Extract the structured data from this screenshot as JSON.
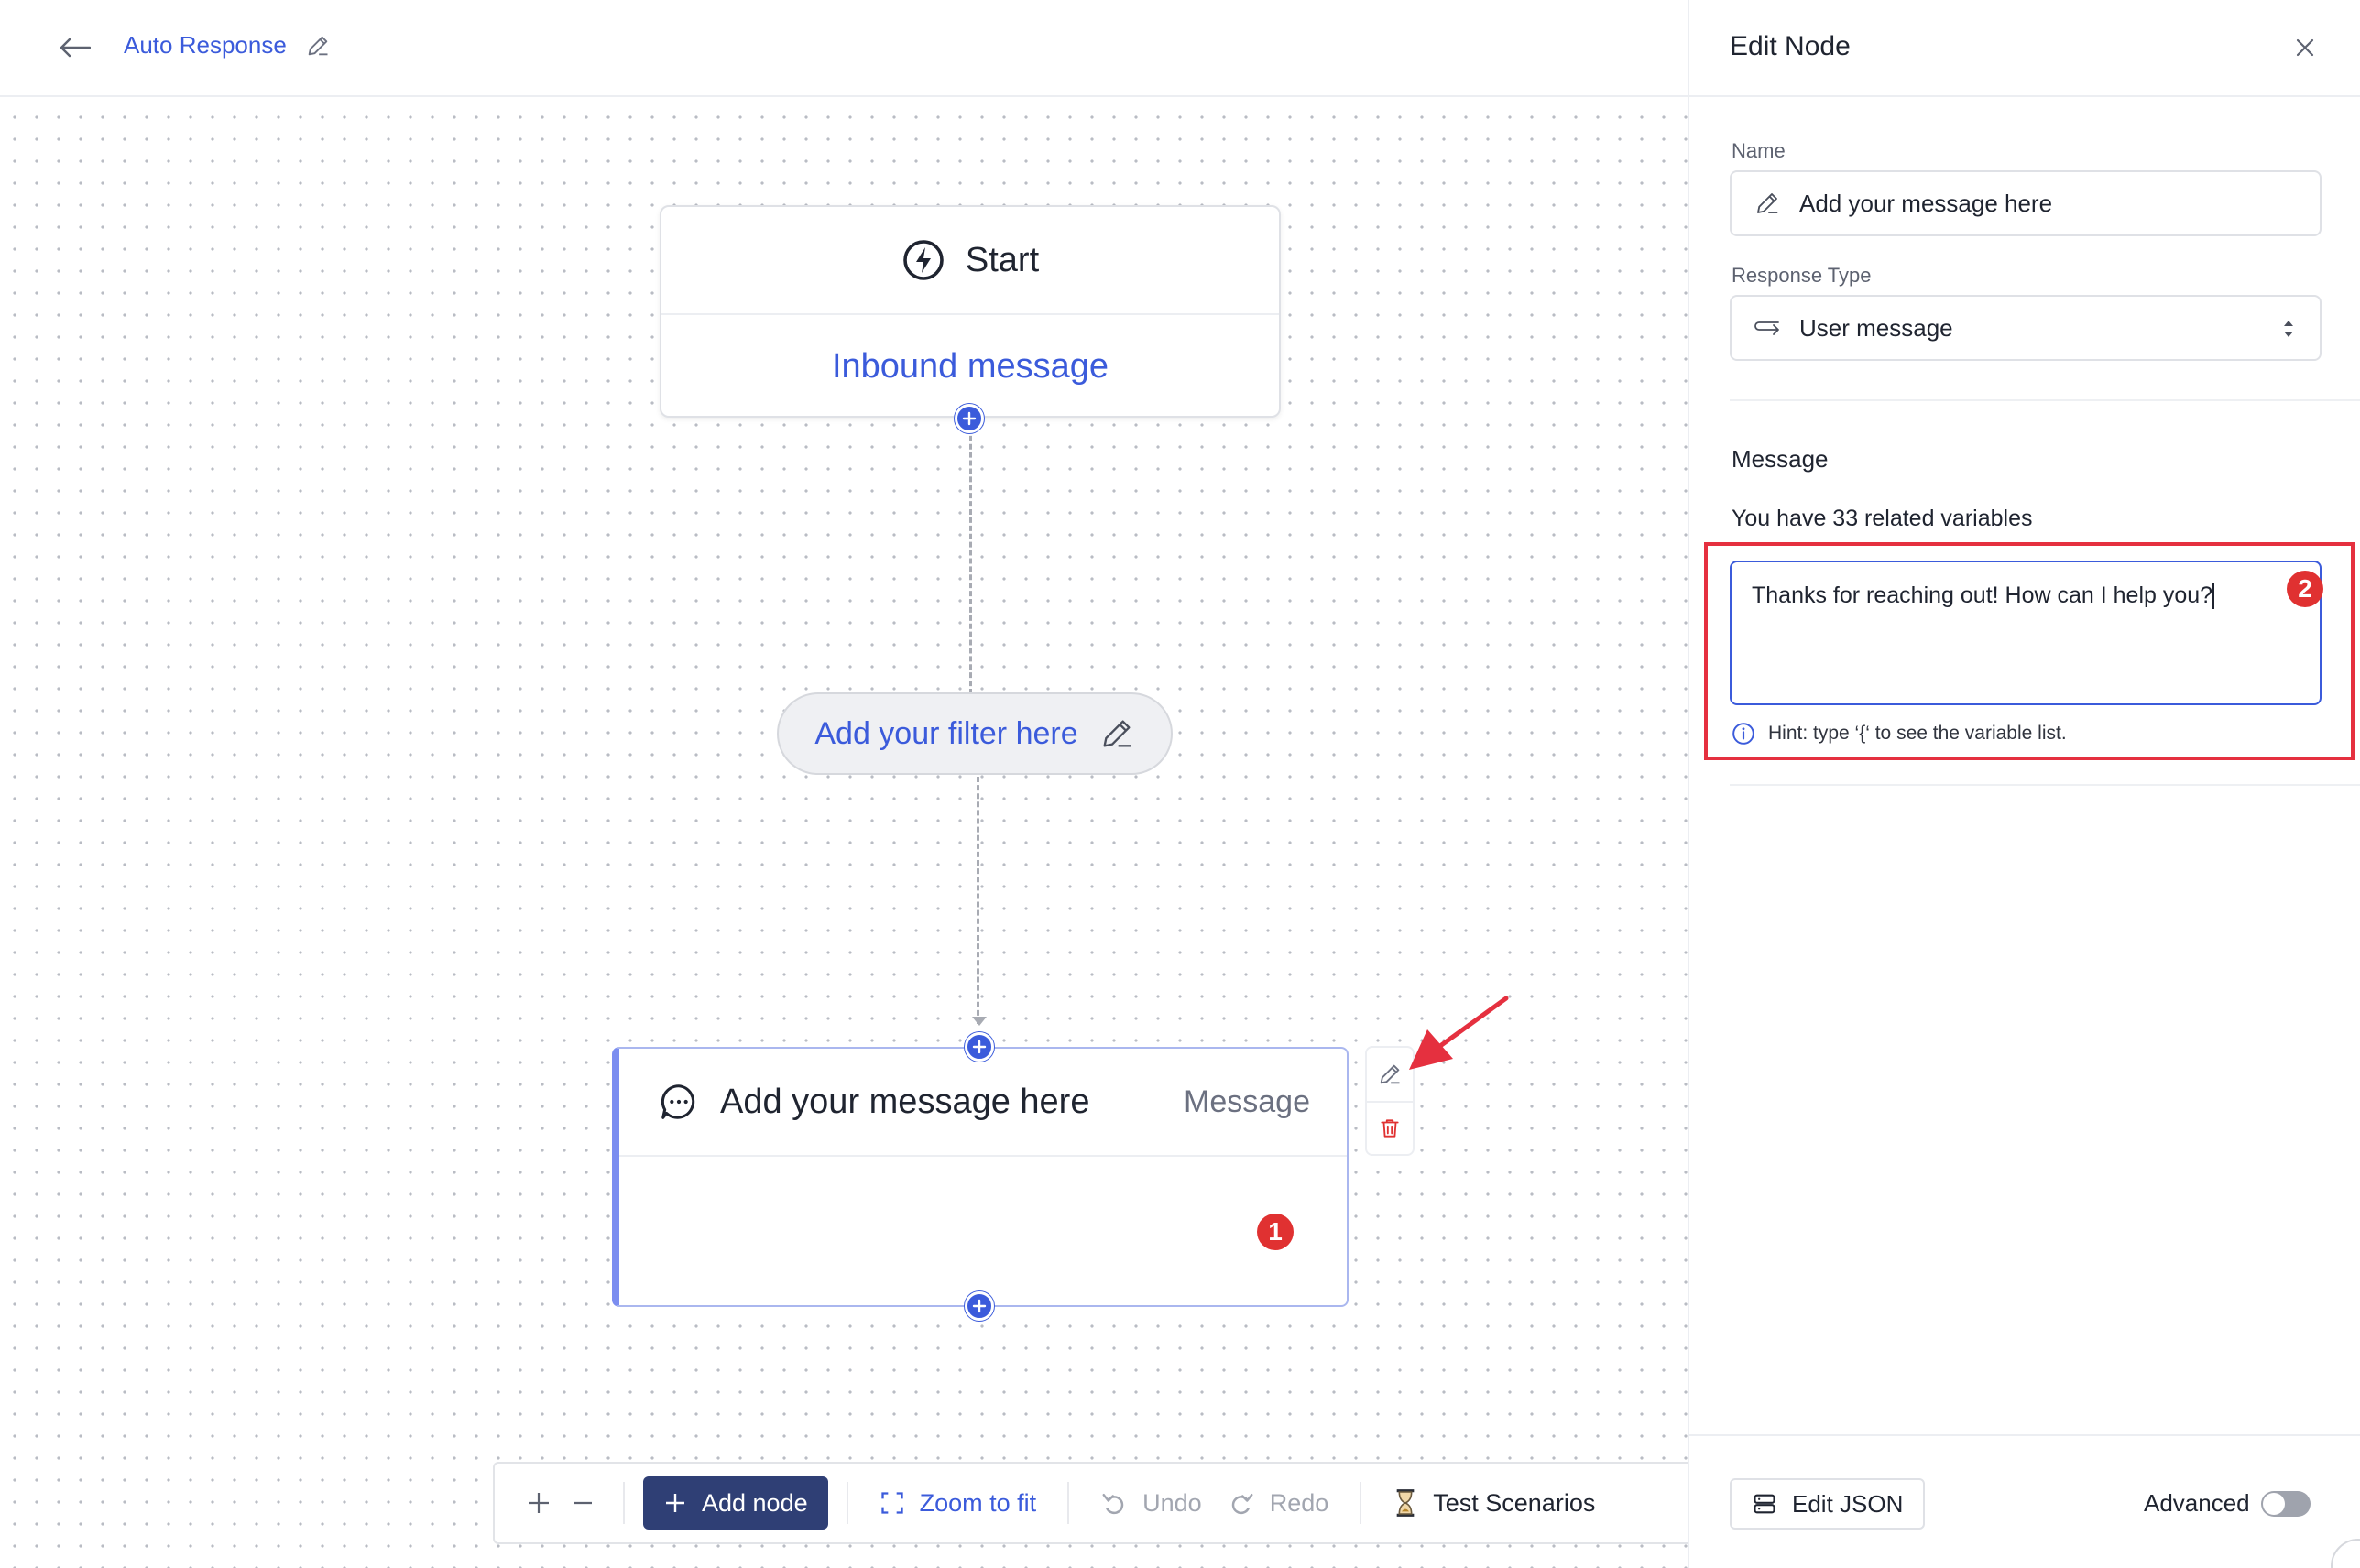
{
  "header": {
    "title": "Auto Response"
  },
  "canvas": {
    "start_node": {
      "label": "Start",
      "trigger": "Inbound message"
    },
    "filter": {
      "label": "Add your filter here"
    },
    "message_node": {
      "title": "Add your message here",
      "type": "Message",
      "badge": "1"
    }
  },
  "toolbar": {
    "add_node": "Add node",
    "zoom_to_fit": "Zoom to fit",
    "undo": "Undo",
    "redo": "Redo",
    "test_scenarios": "Test Scenarios"
  },
  "panel": {
    "title": "Edit Node",
    "name_label": "Name",
    "name_value": "Add your message here",
    "response_type_label": "Response Type",
    "response_type_value": "User message",
    "message_section": "Message",
    "vars_count": "You have 33 related variables",
    "message_text": "Thanks for reaching out! How can I help you?",
    "badge": "2",
    "hint": "Hint: type ‘{‘ to see the variable list.",
    "edit_json": "Edit JSON",
    "advanced": "Advanced",
    "advanced_enabled": false
  },
  "colors": {
    "accent": "#3b5bdb",
    "toolbar_primary": "#2f3f75",
    "highlight": "#e5303f",
    "badge": "#e03131"
  }
}
